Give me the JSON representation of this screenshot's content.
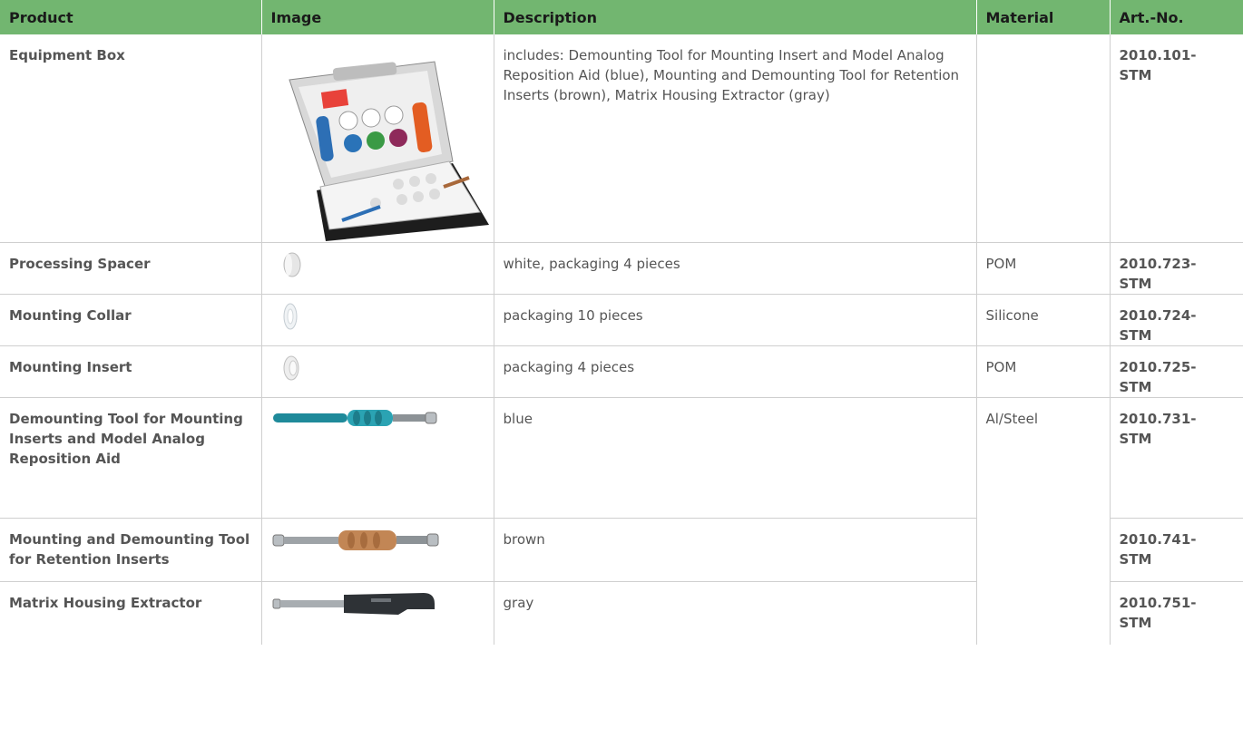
{
  "table": {
    "headers": {
      "product": "Product",
      "image": "Image",
      "description": "Description",
      "material": "Material",
      "art_no": "Art.-No."
    },
    "rows": [
      {
        "product": "Equipment Box",
        "image_icon": "equipment-box-image",
        "description": "includes: Demounting Tool for Mounting Insert and Model Analog Reposition Aid (blue), Mounting and Demounting Tool for Retention Inserts (brown), Matrix Housing Extractor (gray)",
        "material": "",
        "art_no": "2010.101-STM"
      },
      {
        "product": "Processing Spacer",
        "image_icon": "processing-spacer-image",
        "description": "white, packaging 4 pieces",
        "material": "POM",
        "art_no": "2010.723-STM"
      },
      {
        "product": "Mounting Collar",
        "image_icon": "mounting-collar-image",
        "description": "packaging 10 pieces",
        "material": "Silicone",
        "art_no": "2010.724-STM"
      },
      {
        "product": "Mounting Insert",
        "image_icon": "mounting-insert-image",
        "description": "packaging 4 pieces",
        "material": "POM",
        "art_no": "2010.725-STM"
      },
      {
        "product": "Demounting Tool for Mounting Inserts and Model Analog Reposition Aid",
        "image_icon": "blue-demounting-tool-image",
        "description": "blue",
        "material": "Al/Steel",
        "art_no": "2010.731-STM"
      },
      {
        "product": "Mounting and Demounting Tool for Retention Inserts",
        "image_icon": "brown-mounting-tool-image",
        "description": "brown",
        "material": "",
        "art_no": "2010.741-STM"
      },
      {
        "product": "Matrix Housing Extractor",
        "image_icon": "gray-extractor-image",
        "description": "gray",
        "material": "",
        "art_no": "2010.751-STM"
      }
    ],
    "colors": {
      "header_bg": "#72b670",
      "grid": "#cfcfcf",
      "text": "#555555"
    }
  }
}
